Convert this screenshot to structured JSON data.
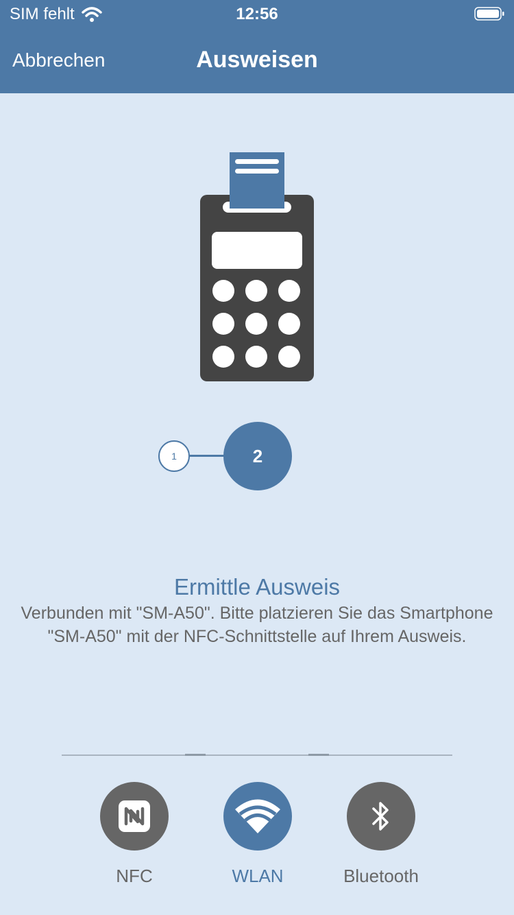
{
  "status_bar": {
    "carrier": "SIM fehlt",
    "time": "12:56"
  },
  "nav": {
    "cancel": "Abbrechen",
    "title": "Ausweisen"
  },
  "steps": {
    "step1": "1",
    "step2": "2",
    "current": 2
  },
  "content": {
    "heading": "Ermittle Ausweis",
    "description": "Verbunden mit \"SM-A50\". Bitte platzieren Sie das Smartphone \"SM-A50\" mit der NFC-Schnittstelle auf Ihrem Ausweis."
  },
  "technologies": [
    {
      "label": "NFC",
      "icon": "nfc-icon",
      "selected": false
    },
    {
      "label": "WLAN",
      "icon": "wifi-icon",
      "selected": true
    },
    {
      "label": "Bluetooth",
      "icon": "bluetooth-icon",
      "selected": false
    }
  ],
  "colors": {
    "primary": "#4d79a6",
    "background": "#dce8f5",
    "inactive": "#666666",
    "device": "#444444"
  }
}
